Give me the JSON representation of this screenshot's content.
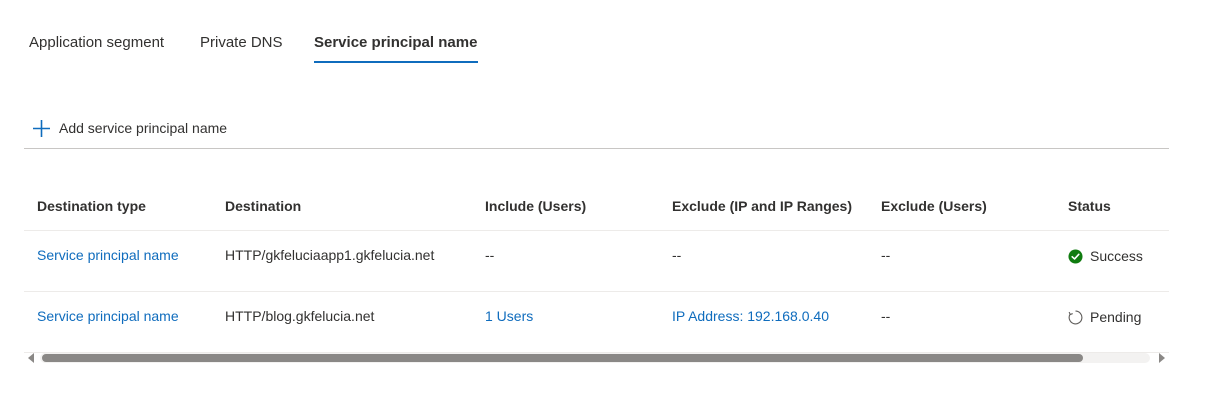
{
  "tabs": [
    {
      "label": "Application segment",
      "active": false
    },
    {
      "label": "Private DNS",
      "active": false
    },
    {
      "label": "Service principal name",
      "active": true
    }
  ],
  "toolbar": {
    "add_label": "Add service principal name",
    "add_icon": "plus-icon"
  },
  "colors": {
    "accent": "#0f6cbd",
    "success": "#107c10",
    "text": "#323130"
  },
  "table": {
    "columns": [
      "Destination type",
      "Destination",
      "Include (Users)",
      "Exclude (IP and IP Ranges)",
      "Exclude (Users)",
      "Status"
    ],
    "rows": [
      {
        "destination_type": "Service principal name",
        "destination": "HTTP/gkfeluciaapp1.gkfelucia.net",
        "include_users": "--",
        "exclude_ip": "--",
        "exclude_users": "--",
        "status": "Success",
        "status_icon": "check-circle-icon"
      },
      {
        "destination_type": "Service principal name",
        "destination": "HTTP/blog.gkfelucia.net",
        "include_users": "1 Users",
        "exclude_ip": "IP Address: 192.168.0.40",
        "exclude_users": "--",
        "status": "Pending",
        "status_icon": "pending-circle-icon"
      }
    ]
  }
}
